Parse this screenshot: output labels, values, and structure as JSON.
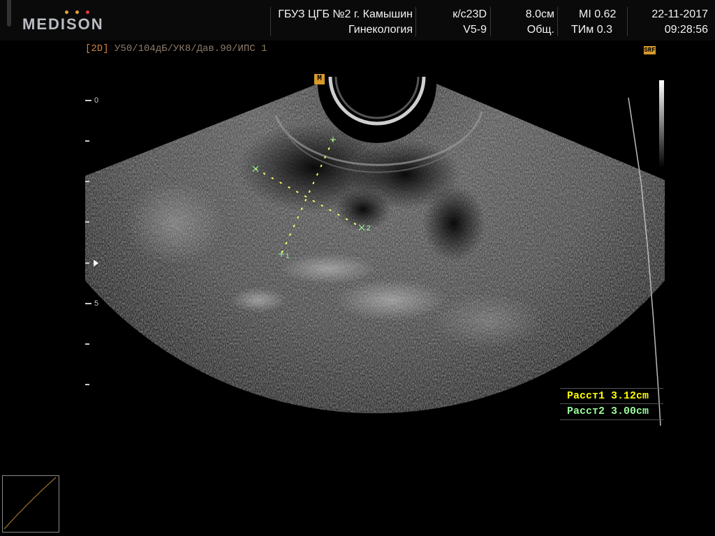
{
  "header": {
    "brand": "MEDISON",
    "brand_dot_colors": [
      "#e0a13a",
      "#e0a13a",
      "#e03a3a"
    ],
    "institution": "ГБУЗ ЦГБ №2 г. Камышин",
    "department": "Гинекология",
    "probe": "к/с23D",
    "preset": "V5-9",
    "depth": "8.0см",
    "mode": "Общ.",
    "mi": "MI  0.62",
    "tim": "ТИм 0.3",
    "date": "22-11-2017",
    "time": "09:28:56"
  },
  "status_line": {
    "mode_tag": "[2D]",
    "params": " У50/104дБ/УК8/Дав.90/ИПС 1"
  },
  "markers": {
    "orientation": "M",
    "srf": "SRF"
  },
  "depth_scale": {
    "labels": [
      "0",
      "5"
    ]
  },
  "caliper_labels": {
    "first": "1",
    "second": "2"
  },
  "measurements": [
    {
      "label": "Расст1 3.12cm",
      "color": "#ffff00"
    },
    {
      "label": "Расст2 3.00cm",
      "color": "#9cff9c"
    }
  ],
  "colors": {
    "accent": "#d1843f",
    "caliper": "#ffff66",
    "caliper_cross": "#9cff9c"
  }
}
